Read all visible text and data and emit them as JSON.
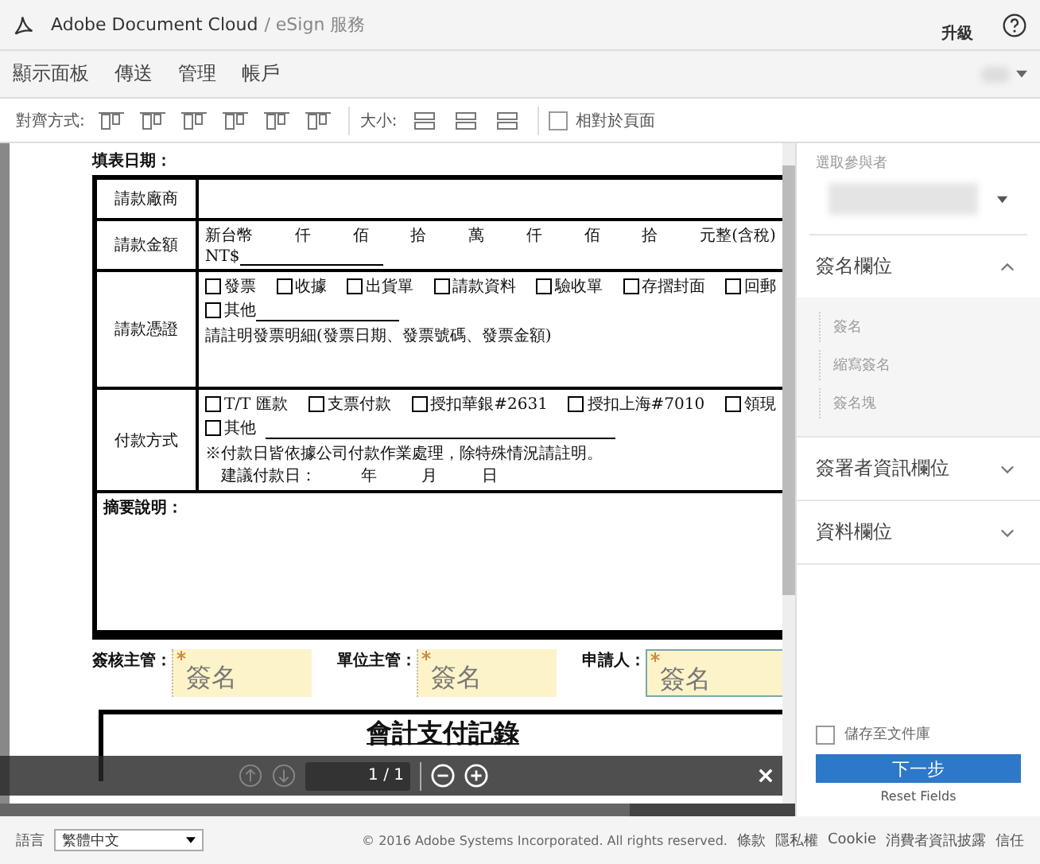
{
  "header": {
    "title": "Adobe Document Cloud",
    "subtitle": "/ eSign 服務",
    "upgrade": "升級"
  },
  "nav": {
    "items": [
      {
        "label": "顯示面板"
      },
      {
        "label": "傳送"
      },
      {
        "label": "管理"
      },
      {
        "label": "帳戶"
      }
    ]
  },
  "toolbar": {
    "align_label": "對齊方式:",
    "size_label": "大小:",
    "relative_to_page": {
      "label": "相對於頁面",
      "checked": false
    }
  },
  "document": {
    "date_label": "填表日期：",
    "rows": [
      {
        "kind": "vendor",
        "label": "請款廠商"
      },
      {
        "kind": "amount",
        "label": "請款金額",
        "units": [
          "新台幣",
          "仟",
          "佰",
          "拾",
          "萬",
          "仟",
          "佰",
          "拾",
          "元整(含稅)"
        ],
        "currency": "NT$"
      },
      {
        "kind": "voucher",
        "label": "請款憑證",
        "options": [
          {
            "label": "發票",
            "checked": false
          },
          {
            "label": "收據",
            "checked": false
          },
          {
            "label": "出貨單",
            "checked": false
          },
          {
            "label": "請款資料",
            "checked": false
          },
          {
            "label": "驗收單",
            "checked": false
          },
          {
            "label": "存摺封面",
            "checked": false
          },
          {
            "label": "回郵",
            "checked": false
          }
        ],
        "other": {
          "label": "其他",
          "checked": false
        },
        "note": "請註明發票明細(發票日期、發票號碼、發票金額)"
      },
      {
        "kind": "payment",
        "label": "付款方式",
        "options": [
          {
            "label": "T/T 匯款",
            "checked": false
          },
          {
            "label": "支票付款",
            "checked": false
          },
          {
            "label": "授扣華銀#2631",
            "checked": false
          },
          {
            "label": "授扣上海#7010",
            "checked": false
          },
          {
            "label": "領現",
            "checked": false
          }
        ],
        "other": {
          "label": "其他",
          "checked": false
        },
        "note": "※付款日皆依據公司付款作業處理，除特殊情況請註明。",
        "suggest": [
          "建議付款日：",
          "年",
          "月",
          "日"
        ]
      },
      {
        "kind": "memo",
        "label": "摘要說明："
      }
    ],
    "signatures": [
      {
        "label": "簽核主管：",
        "field": "簽名",
        "required": true,
        "selected": false
      },
      {
        "label": "單位主管：",
        "field": "簽名",
        "required": true,
        "selected": false
      },
      {
        "label": "申請人：",
        "field": "簽名",
        "required": true,
        "selected": true
      }
    ],
    "next_title": "會計支付記錄"
  },
  "page_bar": {
    "page": "1 / 1"
  },
  "panel": {
    "recipient_label": "選取參與者",
    "sections": [
      {
        "title": "簽名欄位",
        "expanded": true,
        "items": [
          "簽名",
          "縮寫簽名",
          "簽名塊"
        ]
      },
      {
        "title": "簽署者資訊欄位",
        "expanded": false
      },
      {
        "title": "資料欄位",
        "expanded": false
      }
    ],
    "save": {
      "label": "儲存至文件庫",
      "checked": false
    },
    "next": "下一步",
    "reset": "Reset Fields"
  },
  "footer": {
    "language_label": "語言",
    "language": "繁體中文",
    "copyright": "© 2016 Adobe Systems Incorporated. All rights reserved.",
    "links": [
      "條款",
      "隱私權",
      "Cookie",
      "消費者資訊披露",
      "信任"
    ]
  }
}
